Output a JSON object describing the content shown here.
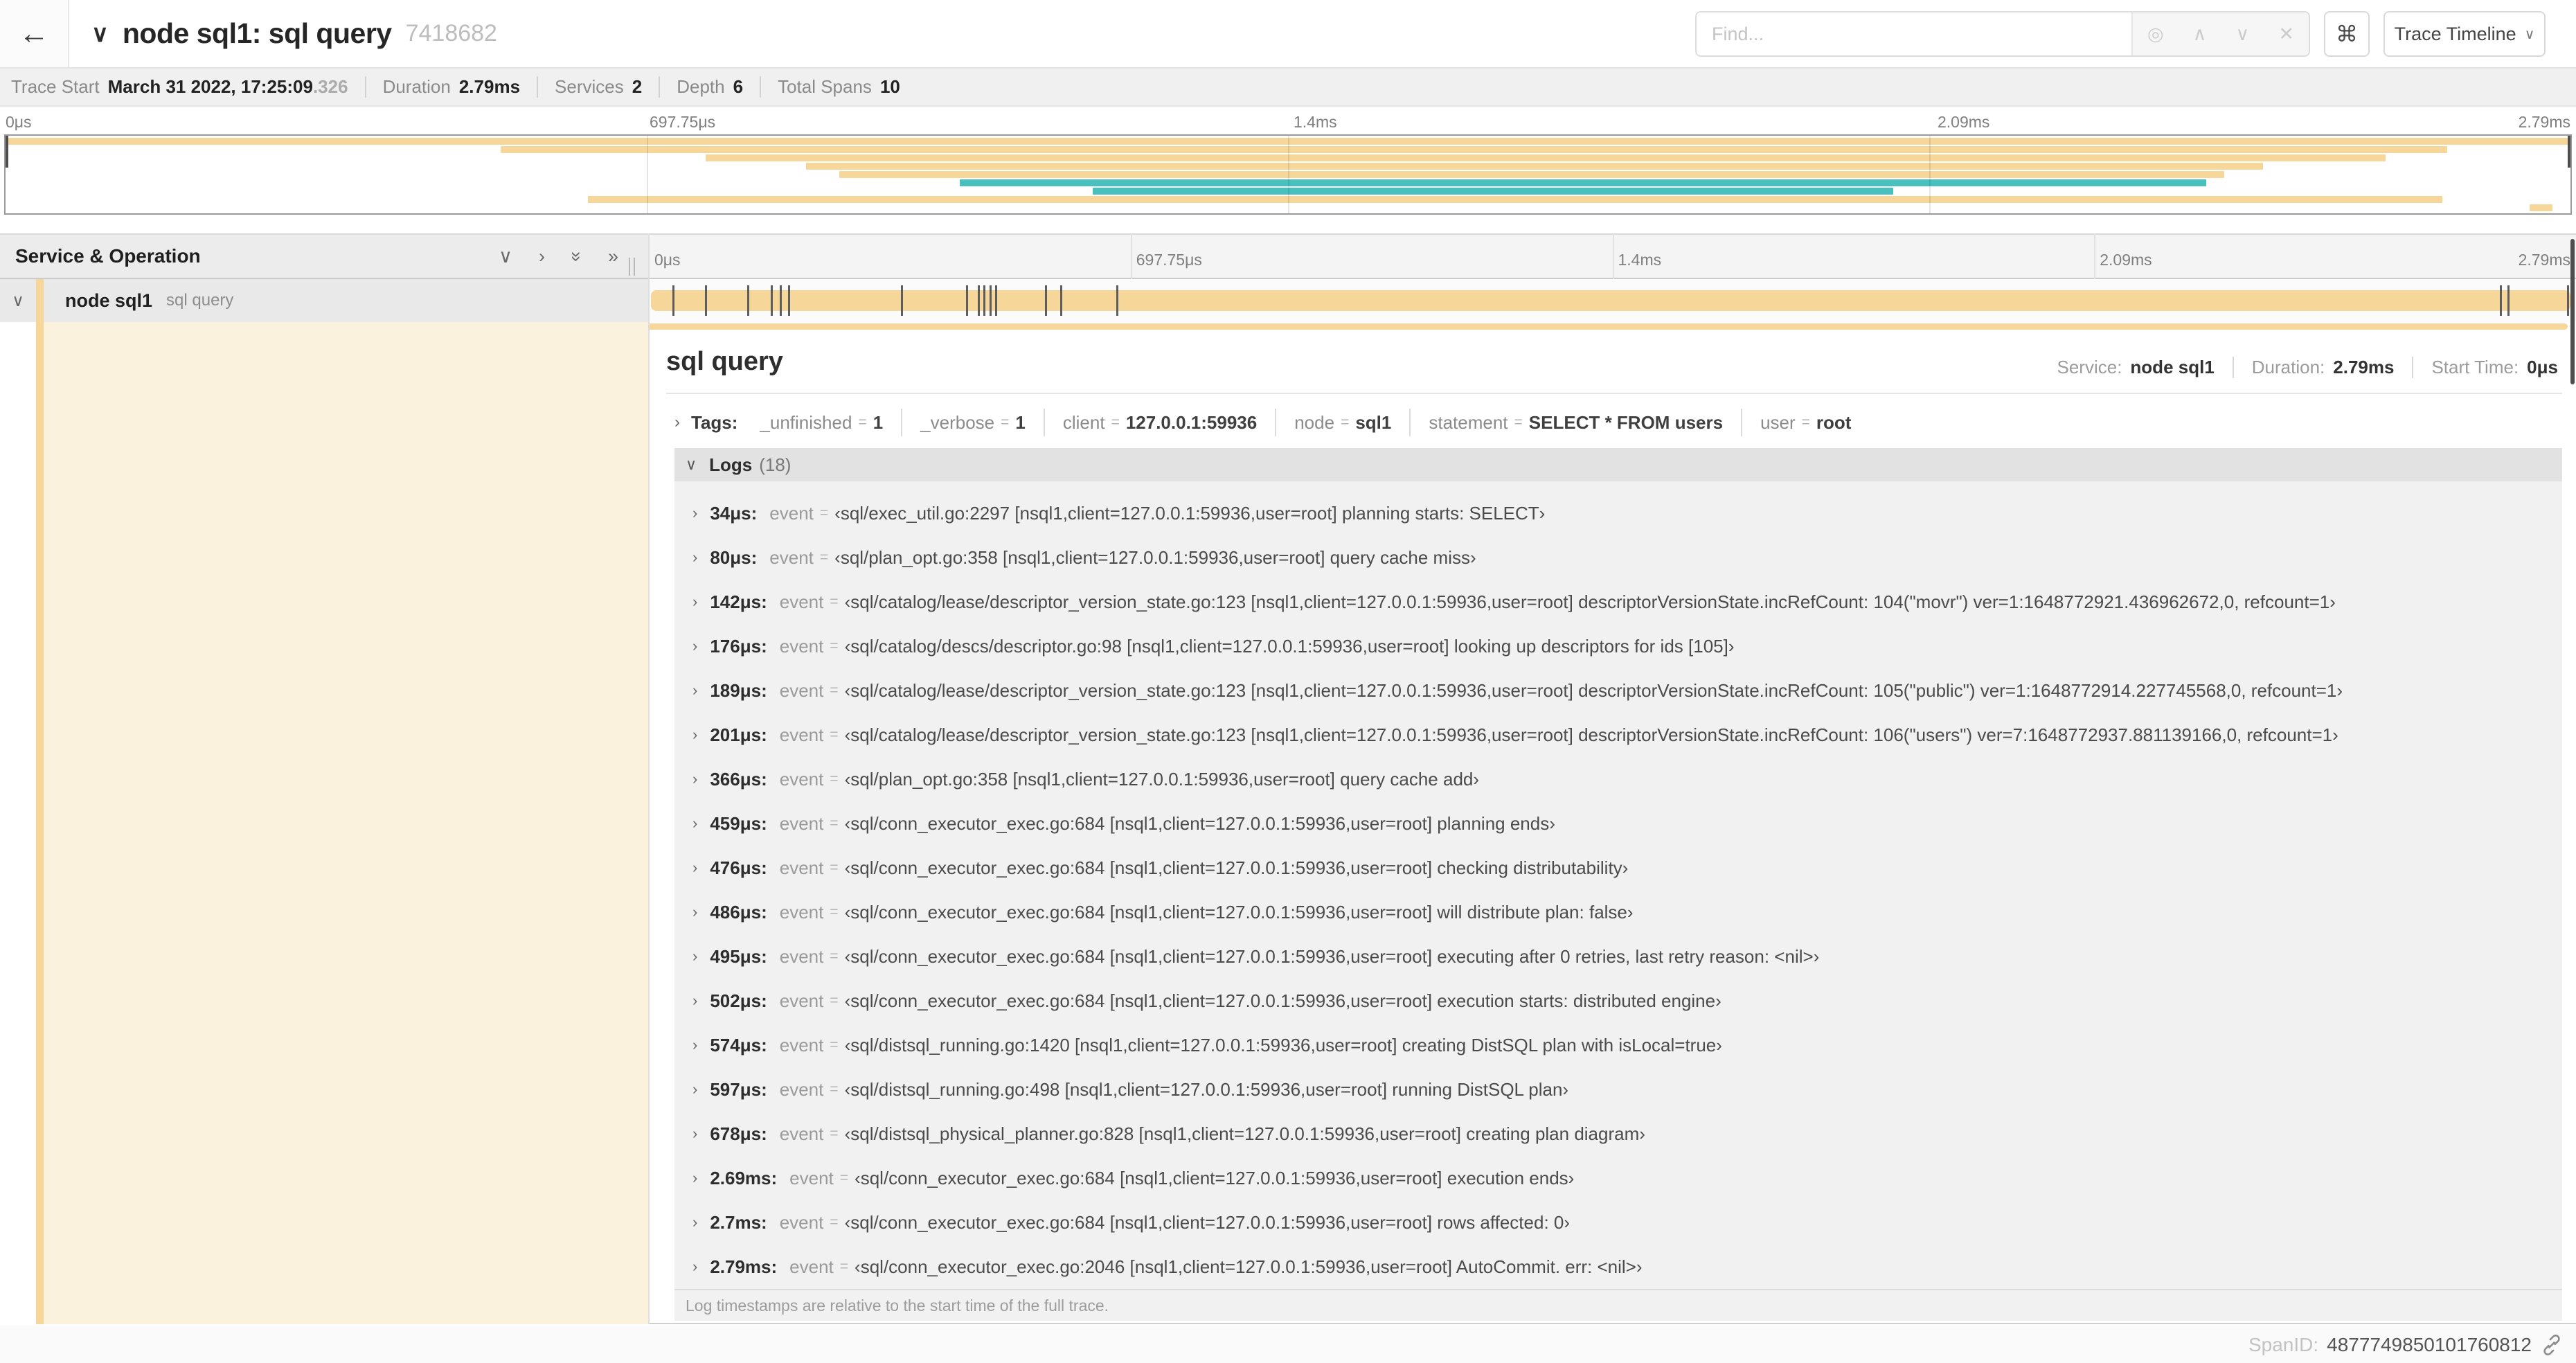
{
  "colors": {
    "span_tan": "#F7D69A",
    "span_teal": "#48C1BE",
    "cream": "#FBF2DD"
  },
  "header": {
    "back_icon": "←",
    "collapse_icon": "∨",
    "title": "node sql1: sql query",
    "trace_id": "7418682",
    "find_placeholder": "Find...",
    "locate_icon": "◎",
    "prev_icon": "∧",
    "next_icon": "∨",
    "clear_icon": "✕",
    "shortcut_icon": "⌘",
    "view_button_label": "Trace Timeline",
    "view_button_chevron": "∨"
  },
  "trace_meta": {
    "items": [
      {
        "label": "Trace Start",
        "value": "March 31 2022, 17:25:09",
        "suffix": ".326"
      },
      {
        "label": "Duration",
        "value": "2.79ms",
        "suffix": ""
      },
      {
        "label": "Services",
        "value": "2",
        "suffix": ""
      },
      {
        "label": "Depth",
        "value": "6",
        "suffix": ""
      },
      {
        "label": "Total Spans",
        "value": "10",
        "suffix": ""
      }
    ]
  },
  "ruler": {
    "labels": [
      "0μs",
      "697.75μs",
      "1.4ms",
      "2.09ms",
      "2.79ms"
    ],
    "positions": [
      0,
      25,
      50,
      75,
      100
    ]
  },
  "minimap": {
    "spans": [
      {
        "start": 0,
        "end": 100,
        "color": "span_tan"
      },
      {
        "start": 19.3,
        "end": 95.2,
        "color": "span_tan"
      },
      {
        "start": 27.3,
        "end": 92.8,
        "color": "span_tan"
      },
      {
        "start": 31.2,
        "end": 88.0,
        "color": "span_tan"
      },
      {
        "start": 32.5,
        "end": 86.5,
        "color": "span_tan"
      },
      {
        "start": 37.2,
        "end": 85.8,
        "color": "span_teal"
      },
      {
        "start": 42.4,
        "end": 73.6,
        "color": "span_teal"
      },
      {
        "start": 22.7,
        "end": 95.0,
        "color": "span_tan"
      },
      {
        "start": 98.4,
        "end": 99.3,
        "color": "span_tan"
      }
    ]
  },
  "timeline": {
    "left_header": "Service & Operation",
    "collapse_one_icon": "∨",
    "expand_one_icon": "›",
    "collapse_all_icon": "»",
    "expand_all_icon": "»",
    "row": {
      "chevron": "∨",
      "service": "node sql1",
      "operation": "sql query"
    }
  },
  "detail": {
    "title": "sql query",
    "service_label": "Service:",
    "service": "node sql1",
    "duration_label": "Duration:",
    "duration": "2.79ms",
    "start_label": "Start Time:",
    "start": "0μs",
    "tags_chevron": "›",
    "tags_label": "Tags:",
    "tags": [
      {
        "key": "_unfinished",
        "value": "1"
      },
      {
        "key": "_verbose",
        "value": "1"
      },
      {
        "key": "client",
        "value": "127.0.0.1:59936"
      },
      {
        "key": "node",
        "value": "sql1"
      },
      {
        "key": "statement",
        "value": "SELECT * FROM users"
      },
      {
        "key": "user",
        "value": "root"
      }
    ],
    "logs_chevron": "∨",
    "logs_label": "Logs",
    "logs_count": "(18)",
    "log_field_key": "event",
    "equals_glyph": "=",
    "row_chevron": "›",
    "logs": [
      {
        "time": "34μs:",
        "pct": 1.2,
        "value": "‹sql/exec_util.go:2297 [nsql1,client=127.0.0.1:59936,user=root] planning starts: SELECT›"
      },
      {
        "time": "80μs:",
        "pct": 2.9,
        "value": "‹sql/plan_opt.go:358 [nsql1,client=127.0.0.1:59936,user=root] query cache miss›"
      },
      {
        "time": "142μs:",
        "pct": 5.1,
        "value": "‹sql/catalog/lease/descriptor_version_state.go:123 [nsql1,client=127.0.0.1:59936,user=root] descriptorVersionState.incRefCount: 104(\"movr\") ver=1:1648772921.436962672,0, refcount=1›"
      },
      {
        "time": "176μs:",
        "pct": 6.3,
        "value": "‹sql/catalog/descs/descriptor.go:98 [nsql1,client=127.0.0.1:59936,user=root] looking up descriptors for ids [105]›"
      },
      {
        "time": "189μs:",
        "pct": 6.8,
        "value": "‹sql/catalog/lease/descriptor_version_state.go:123 [nsql1,client=127.0.0.1:59936,user=root] descriptorVersionState.incRefCount: 105(\"public\") ver=1:1648772914.227745568,0, refcount=1›"
      },
      {
        "time": "201μs:",
        "pct": 7.2,
        "value": "‹sql/catalog/lease/descriptor_version_state.go:123 [nsql1,client=127.0.0.1:59936,user=root] descriptorVersionState.incRefCount: 106(\"users\") ver=7:1648772937.881139166,0, refcount=1›"
      },
      {
        "time": "366μs:",
        "pct": 13.1,
        "value": "‹sql/plan_opt.go:358 [nsql1,client=127.0.0.1:59936,user=root] query cache add›"
      },
      {
        "time": "459μs:",
        "pct": 16.5,
        "value": "‹sql/conn_executor_exec.go:684 [nsql1,client=127.0.0.1:59936,user=root] planning ends›"
      },
      {
        "time": "476μs:",
        "pct": 17.1,
        "value": "‹sql/conn_executor_exec.go:684 [nsql1,client=127.0.0.1:59936,user=root] checking distributability›"
      },
      {
        "time": "486μs:",
        "pct": 17.4,
        "value": "‹sql/conn_executor_exec.go:684 [nsql1,client=127.0.0.1:59936,user=root] will distribute plan: false›"
      },
      {
        "time": "495μs:",
        "pct": 17.7,
        "value": "‹sql/conn_executor_exec.go:684 [nsql1,client=127.0.0.1:59936,user=root] executing after 0 retries, last retry reason: <nil>›"
      },
      {
        "time": "502μs:",
        "pct": 18.0,
        "value": "‹sql/conn_executor_exec.go:684 [nsql1,client=127.0.0.1:59936,user=root] execution starts: distributed engine›"
      },
      {
        "time": "574μs:",
        "pct": 20.6,
        "value": "‹sql/distsql_running.go:1420 [nsql1,client=127.0.0.1:59936,user=root] creating DistSQL plan with isLocal=true›"
      },
      {
        "time": "597μs:",
        "pct": 21.4,
        "value": "‹sql/distsql_running.go:498 [nsql1,client=127.0.0.1:59936,user=root] running DistSQL plan›"
      },
      {
        "time": "678μs:",
        "pct": 24.3,
        "value": "‹sql/distsql_physical_planner.go:828 [nsql1,client=127.0.0.1:59936,user=root] creating plan diagram›"
      },
      {
        "time": "2.69ms:",
        "pct": 96.4,
        "value": "‹sql/conn_executor_exec.go:684 [nsql1,client=127.0.0.1:59936,user=root] execution ends›"
      },
      {
        "time": "2.7ms:",
        "pct": 96.8,
        "value": "‹sql/conn_executor_exec.go:684 [nsql1,client=127.0.0.1:59936,user=root] rows affected: 0›"
      },
      {
        "time": "2.79ms:",
        "pct": 100,
        "value": "‹sql/conn_executor_exec.go:2046 [nsql1,client=127.0.0.1:59936,user=root] AutoCommit. err: <nil>›"
      }
    ],
    "footer_note": "Log timestamps are relative to the start time of the full trace.",
    "span_id_label": "SpanID:",
    "span_id": "4877749850101760812"
  }
}
